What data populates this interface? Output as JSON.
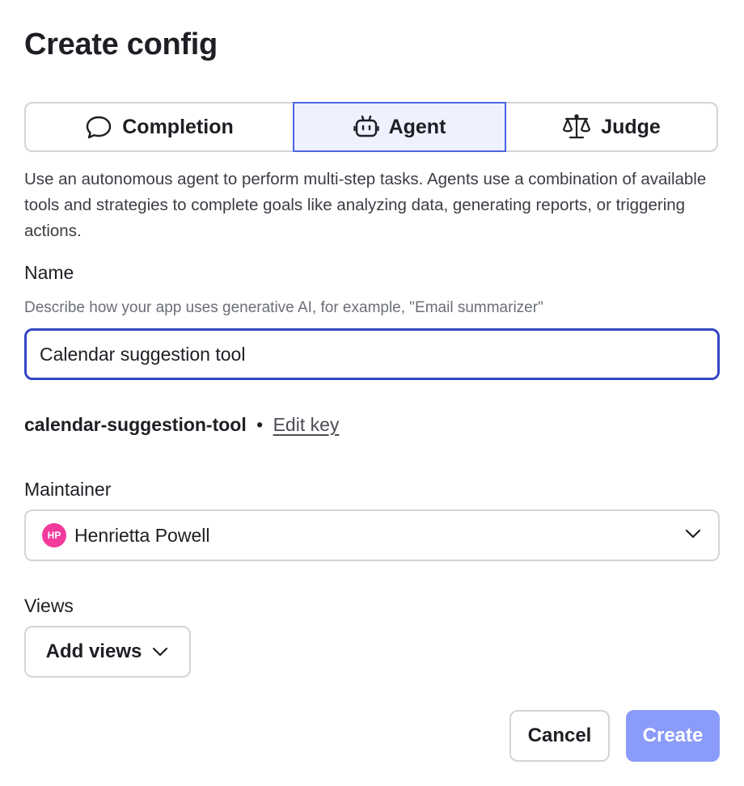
{
  "dialog": {
    "title": "Create config"
  },
  "mode_tabs": [
    {
      "label": "Completion",
      "icon": "chat-bubble-icon",
      "active": false
    },
    {
      "label": "Agent",
      "icon": "robot-icon",
      "active": true
    },
    {
      "label": "Judge",
      "icon": "scale-icon",
      "active": false
    }
  ],
  "description": "Use an autonomous agent to perform multi-step tasks. Agents use a combination of available tools and strategies to complete goals like analyzing data, generating reports, or triggering actions.",
  "name_field": {
    "label": "Name",
    "hint": "Describe how your app uses generative AI, for example, \"Email summarizer\"",
    "value": "Calendar suggestion tool"
  },
  "key": {
    "value": "calendar-suggestion-tool",
    "separator": "•",
    "edit_label": "Edit key"
  },
  "maintainer": {
    "label": "Maintainer",
    "avatar_initials": "HP",
    "value": "Henrietta Powell"
  },
  "views": {
    "label": "Views",
    "button_label": "Add views"
  },
  "footer": {
    "cancel_label": "Cancel",
    "create_label": "Create"
  },
  "colors": {
    "accent": "#3346c4",
    "active_tab_bg": "#eef1fe",
    "create_disabled": "#8b9bf9",
    "avatar": "#f23a9c"
  }
}
